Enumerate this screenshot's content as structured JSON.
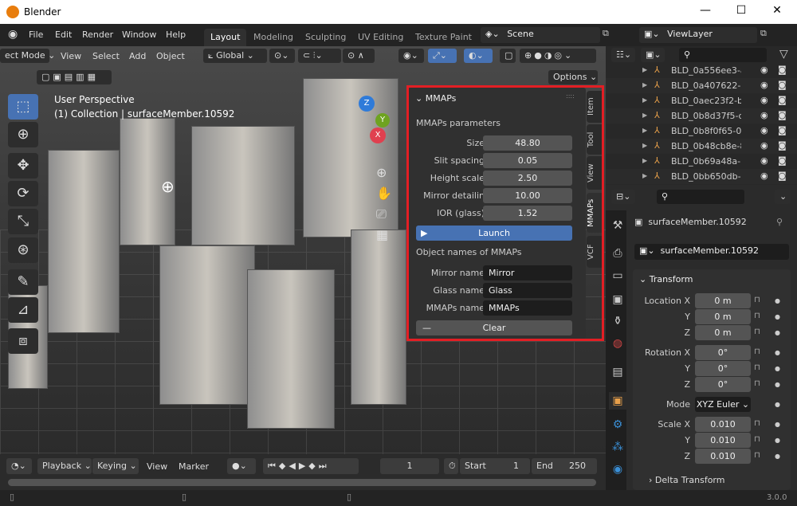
{
  "window": {
    "title": "Blender",
    "controls": [
      "minimize-icon",
      "maximize-icon",
      "close-icon"
    ]
  },
  "menu": [
    "File",
    "Edit",
    "Render",
    "Window",
    "Help"
  ],
  "workspaces": [
    {
      "label": "Layout",
      "active": true
    },
    {
      "label": "Modeling"
    },
    {
      "label": "Sculpting"
    },
    {
      "label": "UV Editing"
    },
    {
      "label": "Texture Paint"
    }
  ],
  "scene": "Scene",
  "view_layer": "ViewLayer",
  "viewport": {
    "mode": "ect Mode",
    "menus": [
      "View",
      "Select",
      "Add",
      "Object"
    ],
    "orientation": "Global",
    "options": "Options",
    "overlay_title": "User Perspective",
    "overlay_sub": "(1) Collection | surfaceMember.10592",
    "gizmo_axes": [
      "X",
      "Y",
      "Z"
    ]
  },
  "npanel": {
    "title": "MMAPs",
    "section1": "MMAPs parameters",
    "params": [
      {
        "label": "Size",
        "value": "48.80"
      },
      {
        "label": "Slit spacing",
        "value": "0.05"
      },
      {
        "label": "Height scale",
        "value": "2.50"
      },
      {
        "label": "Mirror detailin",
        "value": "10.00"
      },
      {
        "label": "IOR (glass)",
        "value": "1.52"
      }
    ],
    "launch": "Launch",
    "section2": "Object names of MMAPs",
    "names": [
      {
        "label": "Mirror name",
        "value": "Mirror"
      },
      {
        "label": "Glass name",
        "value": "Glass"
      },
      {
        "label": "MMAPs name",
        "value": "MMAPs"
      }
    ],
    "clear": "Clear",
    "tabs": [
      {
        "label": "Item"
      },
      {
        "label": "Tool"
      },
      {
        "label": "View"
      },
      {
        "label": "MMAPs",
        "active": true
      },
      {
        "label": "VCF"
      }
    ]
  },
  "outliner": {
    "items": [
      "BLD_0a556ee3-a",
      "BLD_0a407622-e",
      "BLD_0aec23f2-bb",
      "BLD_0b8d37f5-d2",
      "BLD_0b8f0f65-0f.",
      "BLD_0b48cb8e-8",
      "BLD_0b69a48a-7",
      "BLD_0bb650db-2"
    ]
  },
  "properties": {
    "object_name": "surfaceMember.10592",
    "data_name": "surfaceMember.10592",
    "panel": "Transform",
    "location": [
      {
        "label": "Location X",
        "value": "0 m"
      },
      {
        "label": "Y",
        "value": "0 m"
      },
      {
        "label": "Z",
        "value": "0 m"
      }
    ],
    "rotation": [
      {
        "label": "Rotation X",
        "value": "0°"
      },
      {
        "label": "Y",
        "value": "0°"
      },
      {
        "label": "Z",
        "value": "0°"
      }
    ],
    "mode_label": "Mode",
    "mode": "XYZ Euler",
    "scale": [
      {
        "label": "Scale X",
        "value": "0.010"
      },
      {
        "label": "Y",
        "value": "0.010"
      },
      {
        "label": "Z",
        "value": "0.010"
      }
    ],
    "delta": "Delta Transform"
  },
  "timeline": {
    "playback": "Playback",
    "keying": "Keying",
    "view": "View",
    "marker": "Marker",
    "frame": "1",
    "start_label": "Start",
    "start": "1",
    "end_label": "End",
    "end": "250"
  },
  "status": {
    "version": "3.0.0"
  },
  "colors": {
    "accent": "#4772b3",
    "highlight": "#e31e24",
    "object": "#e8a04a"
  }
}
